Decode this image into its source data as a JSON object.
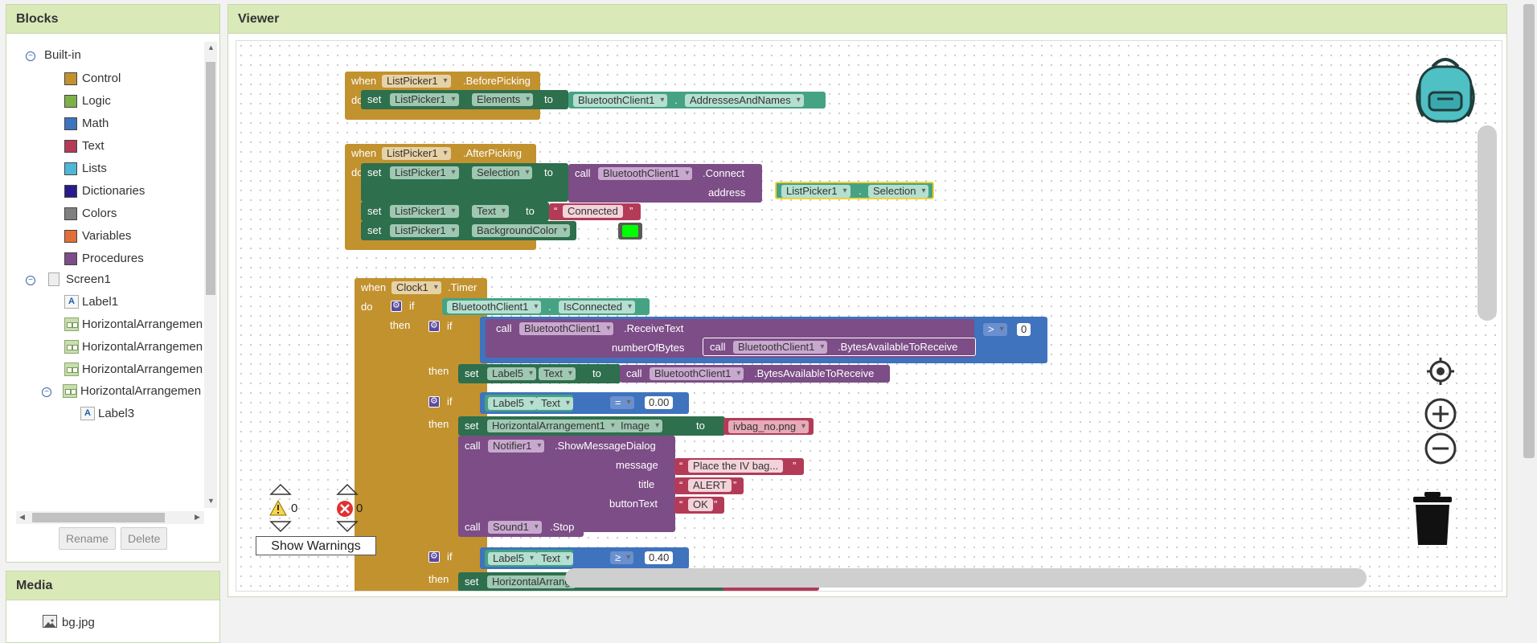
{
  "blocks_panel": {
    "title": "Blocks",
    "builtin_label": "Built-in",
    "categories": [
      {
        "label": "Control",
        "color": "#c2922f"
      },
      {
        "label": "Logic",
        "color": "#7eb04a"
      },
      {
        "label": "Math",
        "color": "#3f73bd"
      },
      {
        "label": "Text",
        "color": "#b33b57"
      },
      {
        "label": "Lists",
        "color": "#4fb6d8"
      },
      {
        "label": "Dictionaries",
        "color": "#2a1b8c"
      },
      {
        "label": "Colors",
        "color": "#808080"
      },
      {
        "label": "Variables",
        "color": "#e26f3a"
      },
      {
        "label": "Procedures",
        "color": "#7c4d86"
      }
    ],
    "components": [
      {
        "label": "Screen1"
      },
      {
        "label": "Label1"
      },
      {
        "label": "HorizontalArrangemen"
      },
      {
        "label": "HorizontalArrangemen"
      },
      {
        "label": "HorizontalArrangemen"
      },
      {
        "label": "HorizontalArrangemen"
      },
      {
        "label": "Label3"
      }
    ],
    "rename_label": "Rename",
    "delete_label": "Delete"
  },
  "media_panel": {
    "title": "Media",
    "items": [
      {
        "label": "bg.jpg"
      }
    ]
  },
  "viewer": {
    "title": "Viewer",
    "warnings_count": "0",
    "errors_count": "0",
    "show_warnings_label": "Show Warnings"
  },
  "blocks": {
    "b1": {
      "when": "when",
      "component": "ListPicker1",
      "event": ".BeforePicking",
      "do": "do",
      "set": "set",
      "set_component": "ListPicker1",
      "property": "Elements",
      "to": "to",
      "value_component": "BluetoothClient1",
      "value_property": "AddressesAndNames"
    },
    "b2": {
      "when": "when",
      "component": "ListPicker1",
      "event": ".AfterPicking",
      "do": "do",
      "s1_set": "set",
      "s1_component": "ListPicker1",
      "s1_property": "Selection",
      "s1_to": "to",
      "call": "call",
      "call_component": "BluetoothClient1",
      "call_method": ".Connect",
      "address_label": "address",
      "addr_component": "ListPicker1",
      "addr_property": "Selection",
      "s2_set": "set",
      "s2_component": "ListPicker1",
      "s2_property": "Text",
      "s2_to": "to",
      "s2_value": "Connected",
      "s3_set": "set",
      "s3_component": "ListPicker1",
      "s3_property": "BackgroundColor",
      "s3_to": "to",
      "s3_color": "#00ff00"
    },
    "b3": {
      "when": "when",
      "component": "Clock1",
      "event": ".Timer",
      "do": "do",
      "if1": "if",
      "if1_component": "BluetoothClient1",
      "if1_property": "IsConnected",
      "then1": "then",
      "if2": "if",
      "call1": "call",
      "call1_component": "BluetoothClient1",
      "call1_method": ".ReceiveText",
      "numbytes_label": "numberOfBytes",
      "call2": "call",
      "call2_component": "BluetoothClient1",
      "call2_method": ".BytesAvailableToReceive",
      "cmp1": ">",
      "cmp1_value": "0",
      "then2": "then",
      "set2": "set",
      "set2_component": "Label5",
      "set2_property": "Text",
      "set2_to": "to",
      "call3": "call",
      "call3_component": "BluetoothClient1",
      "call3_method": ".BytesAvailableToReceive",
      "if3": "if",
      "if3_component": "Label5",
      "if3_property": "Text",
      "cmp2": "=",
      "cmp2_value": "0.00",
      "then3": "then",
      "set3": "set",
      "set3_component": "HorizontalArrangement1",
      "set3_property": "Image",
      "set3_to": "to",
      "set3_value": "ivbag_no.png",
      "call4": "call",
      "call4_component": "Notifier1",
      "call4_method": ".ShowMessageDialog",
      "message_label": "message",
      "message_value": "Place the IV bag...",
      "title_label": "title",
      "title_value": "ALERT",
      "buttontext_label": "buttonText",
      "buttontext_value": "OK",
      "call5": "call",
      "call5_component": "Sound1",
      "call5_method": ".Stop",
      "if4": "if",
      "if4_component": "Label5",
      "if4_property": "Text",
      "cmp3": "≥",
      "cmp3_value": "0.40",
      "then4": "then",
      "set4": "set",
      "set4_component": "HorizontalArrang"
    }
  }
}
